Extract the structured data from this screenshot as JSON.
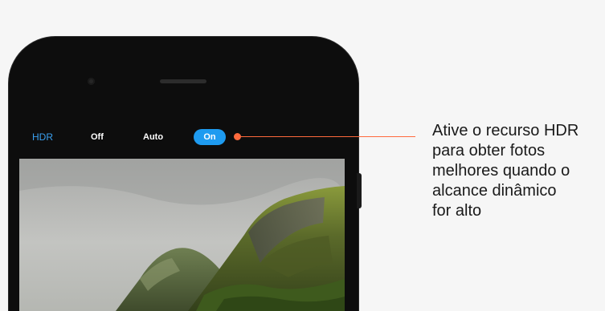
{
  "toolbar": {
    "hdr_label": "HDR",
    "options": [
      {
        "label": "Off",
        "selected": false
      },
      {
        "label": "Auto",
        "selected": false
      },
      {
        "label": "On",
        "selected": true
      }
    ]
  },
  "callout": {
    "lines": [
      "Ative o recurso HDR",
      "para obter fotos",
      "melhores quando o",
      "alcance dinâmico",
      "for alto"
    ]
  },
  "colors": {
    "accent": "#1e9bf0",
    "hdr_label": "#3aa0ef",
    "callout": "#ff6a3d",
    "phone_body": "#0d0d0d",
    "background": "#f6f6f6"
  },
  "icons": {
    "front_camera": "front-camera-icon",
    "earpiece": "earpiece-slot"
  }
}
